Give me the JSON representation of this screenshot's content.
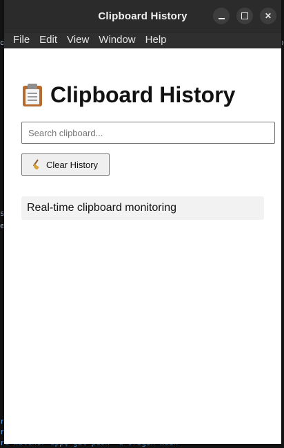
{
  "window": {
    "title": "Clipboard History"
  },
  "menubar": {
    "items": [
      "File",
      "Edit",
      "View",
      "Window",
      "Help"
    ]
  },
  "main": {
    "title": "Clipboard History",
    "title_icon": "clipboard-icon",
    "search": {
      "placeholder": "Search clipboard...",
      "value": ""
    },
    "clear_button": {
      "label": "Clear History",
      "icon": "broom-icon"
    },
    "status_text": "Real-time clipboard monitoring"
  },
  "background": {
    "lines": [
      {
        "text": "o"
      },
      {
        "text": "o"
      },
      {
        "text": "s"
      },
      {
        "text": "e"
      },
      {
        "text": "ro"
      },
      {
        "text": "ro"
      },
      {
        "text": "rd-watcher-app$ git push -u origin main"
      }
    ]
  },
  "colors": {
    "titlebar": "#2b2b2b",
    "menubar": "#2f2f2f",
    "window_bg": "#ffffff",
    "status_bg": "#f2f2f2",
    "button_bg": "#efefef"
  }
}
